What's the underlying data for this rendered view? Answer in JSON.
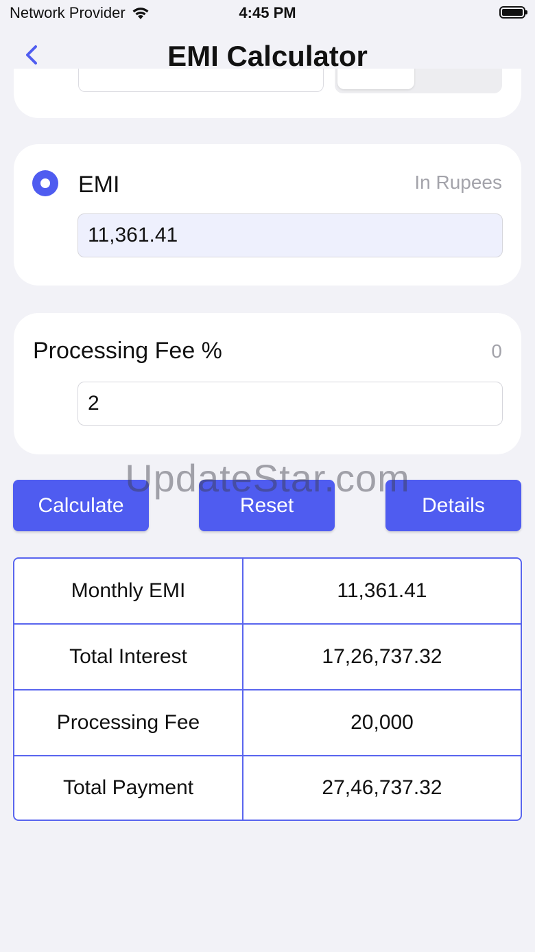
{
  "status_bar": {
    "carrier": "Network Provider",
    "time": "4:45 PM"
  },
  "nav": {
    "title": "EMI Calculator"
  },
  "emi_card": {
    "label": "EMI",
    "unit_hint": "In Rupees",
    "value": "11,361.41",
    "selected": true
  },
  "fee_card": {
    "label": "Processing Fee %",
    "hint": "0",
    "value": "2"
  },
  "buttons": {
    "calculate": "Calculate",
    "reset": "Reset",
    "details": "Details"
  },
  "watermark": "UpdateStar.com",
  "results": [
    {
      "label": "Monthly EMI",
      "value": "11,361.41"
    },
    {
      "label": "Total Interest",
      "value": "17,26,737.32"
    },
    {
      "label": "Processing Fee",
      "value": "20,000"
    },
    {
      "label": "Total Payment",
      "value": "27,46,737.32"
    }
  ],
  "colors": {
    "accent": "#4f5cf0",
    "background": "#f2f2f7",
    "table_border": "#5965ee"
  }
}
